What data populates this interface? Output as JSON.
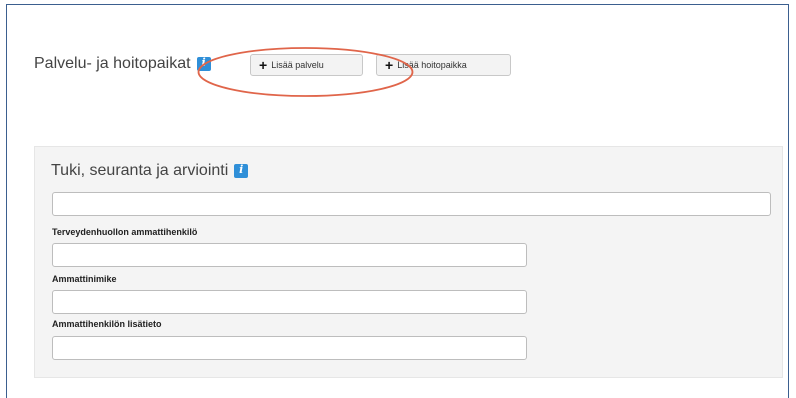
{
  "services_section": {
    "title": "Palvelu- ja hoitopaikat",
    "add_service_label": "Lisää palvelu",
    "add_place_label": "Lisää hoitopaikka"
  },
  "support_panel": {
    "title": "Tuki, seuranta ja arviointi",
    "main_input_value": "",
    "fields": [
      {
        "label": "Terveydenhuollon ammattihenkilö",
        "value": ""
      },
      {
        "label": "Ammattinimike",
        "value": ""
      },
      {
        "label": "Ammattihenkilön lisätieto",
        "value": ""
      }
    ]
  },
  "icons": {
    "info": "info-icon",
    "plus": "plus-icon"
  },
  "colors": {
    "info_icon": "#2f8fd8",
    "highlight_ellipse": "#e0654a",
    "frame_border": "#3b5f8f",
    "panel_background": "#f4f4f4"
  }
}
